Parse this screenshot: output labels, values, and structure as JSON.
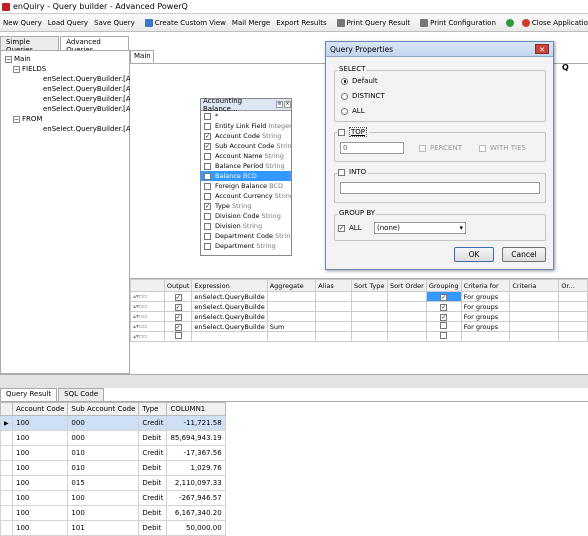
{
  "window": {
    "title": "enQuiry - Query builder - Advanced PowerQ"
  },
  "toolbar": [
    {
      "label": "New Query",
      "icon": "new-query-icon",
      "color": ""
    },
    {
      "label": "Load Query",
      "icon": "load-query-icon",
      "color": ""
    },
    {
      "label": "Save Query",
      "icon": "save-query-icon",
      "color": ""
    },
    {
      "label": "Create Custom View",
      "icon": "custom-view-icon",
      "color": "#3a78c9"
    },
    {
      "label": "Mail Merge",
      "icon": "mail-merge-icon",
      "color": ""
    },
    {
      "label": "Export Results",
      "icon": "export-icon",
      "color": ""
    },
    {
      "label": "Print Query Result",
      "icon": "print-result-icon",
      "color": "#555555"
    },
    {
      "label": "Print Configuration",
      "icon": "print-config-icon",
      "color": "#555555"
    },
    {
      "label": "",
      "icon": "refresh-icon",
      "color": "#2e9a3a"
    },
    {
      "label": "Close Application",
      "icon": "close-app-icon",
      "color": "#d23a2a"
    }
  ],
  "left_tabs": [
    "Simple Queries",
    "Advanced Queries"
  ],
  "tree": {
    "main": "Main",
    "fields": "FIELDS",
    "field_items": [
      "enSelect.QueryBuilder.[Acco",
      "enSelect.QueryBuilder.[Acco",
      "enSelect.QueryBuilder.[Acco",
      "enSelect.QueryBuilder.[Acco"
    ],
    "from": "FROM",
    "from_items": [
      "enSelect.QueryBuilder.[Acco"
    ]
  },
  "main_tab": "Main",
  "table_box": {
    "title": "Accounting Balance...",
    "fields": [
      {
        "name": "*",
        "type": "",
        "checked": false,
        "selected": false
      },
      {
        "name": "Entity Link Field",
        "type": "Integer",
        "checked": false,
        "selected": false
      },
      {
        "name": "Account Code",
        "type": "String",
        "checked": true,
        "selected": false
      },
      {
        "name": "Sub Account Code",
        "type": "String",
        "checked": true,
        "selected": false
      },
      {
        "name": "Account Name",
        "type": "String",
        "checked": false,
        "selected": false
      },
      {
        "name": "Balance Period",
        "type": "String",
        "checked": false,
        "selected": false
      },
      {
        "name": "Balance",
        "type": "BCD",
        "checked": false,
        "selected": true
      },
      {
        "name": "Foreign Balance",
        "type": "BCD",
        "checked": false,
        "selected": false
      },
      {
        "name": "Account Currency",
        "type": "String",
        "checked": false,
        "selected": false
      },
      {
        "name": "Type",
        "type": "String",
        "checked": true,
        "selected": false
      },
      {
        "name": "Division Code",
        "type": "String",
        "checked": false,
        "selected": false
      },
      {
        "name": "Division",
        "type": "String",
        "checked": false,
        "selected": false
      },
      {
        "name": "Department Code",
        "type": "String",
        "checked": false,
        "selected": false
      },
      {
        "name": "Department",
        "type": "String",
        "checked": false,
        "selected": false
      }
    ]
  },
  "criteria_grid": {
    "headers": [
      "Output",
      "Expression",
      "Aggregate",
      "Alias",
      "Sort Type",
      "Sort Order",
      "Grouping",
      "Criteria for",
      "Criteria",
      "Or..."
    ],
    "rows": [
      {
        "output": true,
        "expression": "enSelect.QueryBuilde",
        "aggregate": "",
        "grouping": true,
        "criteria_for": "For groups"
      },
      {
        "output": true,
        "expression": "enSelect.QueryBuilde",
        "aggregate": "",
        "grouping": true,
        "criteria_for": "For groups"
      },
      {
        "output": true,
        "expression": "enSelect.QueryBuilde",
        "aggregate": "",
        "grouping": true,
        "criteria_for": "For groups"
      },
      {
        "output": true,
        "expression": "enSelect.QueryBuilde",
        "aggregate": "Sum",
        "grouping": false,
        "criteria_for": "For groups"
      },
      {
        "output": false,
        "expression": "",
        "aggregate": "",
        "grouping": false,
        "criteria_for": ""
      }
    ]
  },
  "bottom_tabs": [
    "Query Result",
    "SQL Code"
  ],
  "results": {
    "headers": [
      "Account Code",
      "Sub Account Code",
      "Type",
      "COLUMN1"
    ],
    "rows": [
      [
        "100",
        "000",
        "Credit",
        "-11,721.58"
      ],
      [
        "100",
        "000",
        "Debit",
        "85,694,943.19"
      ],
      [
        "100",
        "010",
        "Credit",
        "-17,367.56"
      ],
      [
        "100",
        "010",
        "Debit",
        "1,029.76"
      ],
      [
        "100",
        "015",
        "Debit",
        "2,110,097.33"
      ],
      [
        "100",
        "100",
        "Credit",
        "-267,946.57"
      ],
      [
        "100",
        "100",
        "Debit",
        "6,167,340.20"
      ],
      [
        "100",
        "101",
        "Debit",
        "50,000.00"
      ]
    ]
  },
  "dialog": {
    "title": "Query Properties",
    "close": "✕",
    "select_group": "SELECT",
    "select_options": [
      "Default",
      "DISTINCT",
      "ALL"
    ],
    "top_label": "TOP",
    "top_value": "0",
    "percent": "PERCENT",
    "with_ties": "WITH TIES",
    "into_label": "INTO",
    "into_value": "",
    "group_by": "GROUP BY",
    "all_label": "ALL",
    "group_select": "(none)",
    "ok": "OK",
    "cancel": "Cancel"
  },
  "right_letter": "Q"
}
